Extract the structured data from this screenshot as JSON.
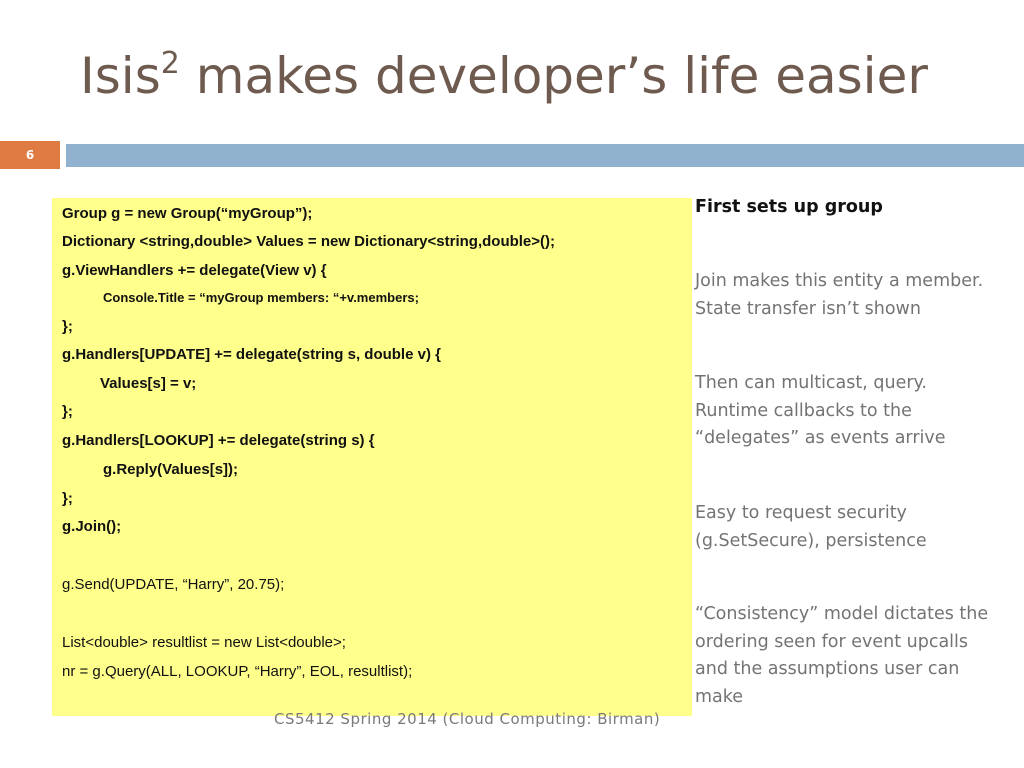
{
  "slide": {
    "title_prefix": "Isis",
    "title_sup": "2",
    "title_rest": " makes developer’s life easier",
    "number": "6",
    "footer": "CS5412 Spring 2014 (Cloud Computing: Birman)"
  },
  "code_lines": [
    "Group g = new Group(“myGroup”);",
    "Dictionary <string,double> Values = new Dictionary<string,double>();",
    "g.ViewHandlers += delegate(View v) {",
    "Console.Title = “myGroup members: “+v.members;",
    "};",
    "g.Handlers[UPDATE] += delegate(string s, double v) {",
    "Values[s] = v;",
    "};",
    "g.Handlers[LOOKUP] += delegate(string s) {",
    "g.Reply(Values[s]);",
    "};",
    "g.Join();",
    "g.Send(UPDATE, “Harry”, 20.75);",
    "List<double> resultlist = new List<double>;",
    "nr = g.Query(ALL, LOOKUP, “Harry”, EOL, resultlist);"
  ],
  "notes": [
    [
      "First sets up group"
    ],
    [
      "Join makes this entity a member.",
      "State transfer isn’t shown"
    ],
    [
      "Then can multicast, query.",
      "Runtime callbacks to the",
      "“delegates” as events arrive"
    ],
    [
      "Easy to request security",
      "(g.SetSecure), persistence"
    ],
    [
      "“Consistency” model dictates the",
      "ordering seen for event upcalls",
      "and the assumptions user can",
      "make"
    ]
  ]
}
